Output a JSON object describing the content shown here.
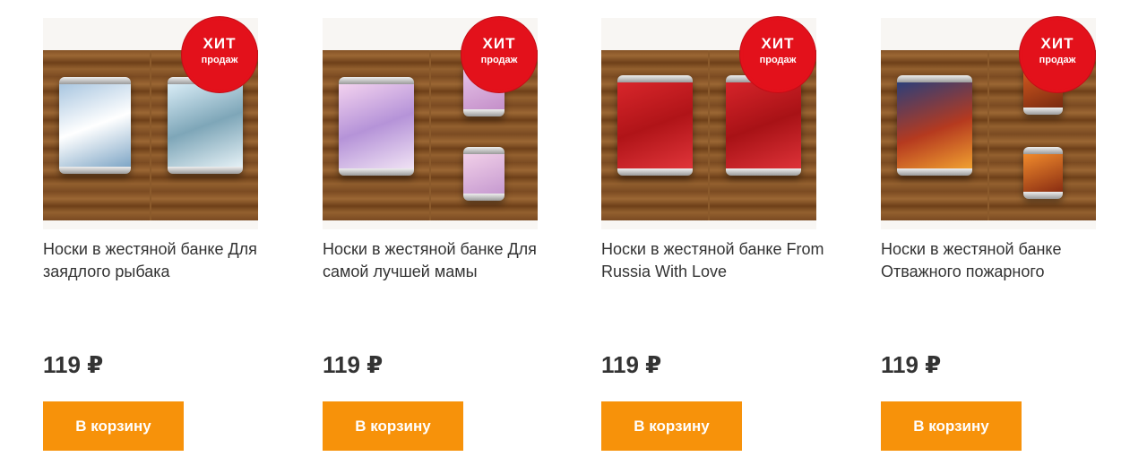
{
  "products": [
    {
      "badge": {
        "line1": "ХИТ",
        "line2": "продаж"
      },
      "title": "Носки в жестяной банке Для заядлого рыбака",
      "price": "119 ₽",
      "button": "В корзину"
    },
    {
      "badge": {
        "line1": "ХИТ",
        "line2": "продаж"
      },
      "title": "Носки в жестяной банке Для самой лучшей мамы",
      "price": "119 ₽",
      "button": "В корзину"
    },
    {
      "badge": {
        "line1": "ХИТ",
        "line2": "продаж"
      },
      "title": "Носки в жестяной банке From Russia With Love",
      "price": "119 ₽",
      "button": "В корзину"
    },
    {
      "badge": {
        "line1": "ХИТ",
        "line2": "продаж"
      },
      "title": "Носки в жестяной банке Отважного пожарного",
      "price": "119 ₽",
      "button": "В корзину"
    }
  ],
  "colors": {
    "accent": "#f7920a",
    "badge": "#e3111b",
    "text": "#333333"
  }
}
